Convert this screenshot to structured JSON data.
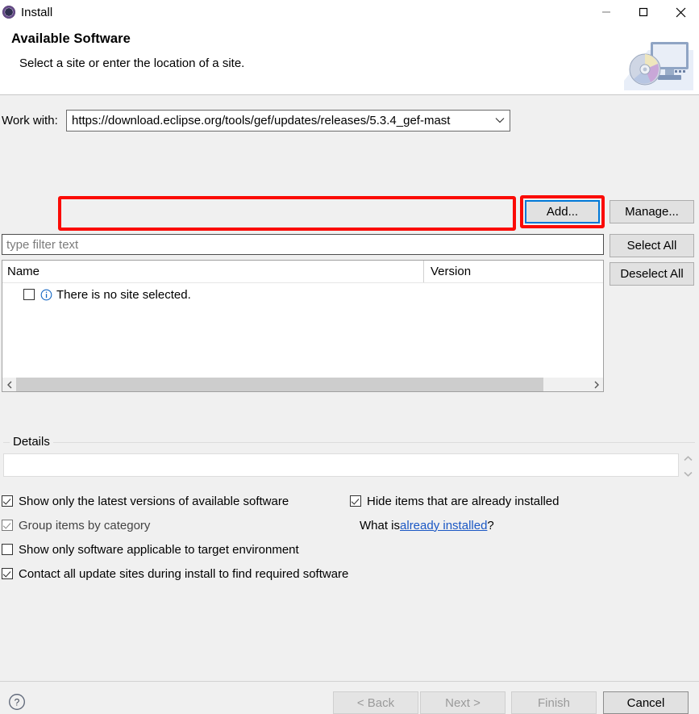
{
  "window": {
    "title": "Install",
    "app_icon": "install-gear-icon",
    "minimize_label": "Minimize",
    "maximize_label": "Maximize",
    "close_label": "Close"
  },
  "banner": {
    "heading": "Available Software",
    "subheading": "Select a site or enter the location of a site.",
    "graphic": "monitor-with-disc-icon"
  },
  "work_with": {
    "label": "Work with:",
    "value": "https://download.eclipse.org/tools/gef/updates/releases/5.3.4_gef-mast",
    "dropdown_icon": "chevron-down-icon",
    "add_label": "Add...",
    "manage_label": "Manage..."
  },
  "filter": {
    "placeholder": "type filter text",
    "value": ""
  },
  "table": {
    "columns": [
      "Name",
      "Version"
    ],
    "rows": [
      {
        "checked": false,
        "icon": "info-icon",
        "name": "There is no site selected.",
        "version": ""
      }
    ],
    "select_all_label": "Select All",
    "deselect_all_label": "Deselect All",
    "scroll_left_icon": "chevron-left-icon",
    "scroll_right_icon": "chevron-right-icon"
  },
  "details": {
    "legend": "Details",
    "text": "",
    "spinner_up_icon": "chevron-up-icon",
    "spinner_down_icon": "chevron-down-icon"
  },
  "options": {
    "left": [
      {
        "label": "Show only the latest versions of available software",
        "checked": true,
        "enabled": true
      },
      {
        "label": "Group items by category",
        "checked": true,
        "enabled": false
      },
      {
        "label": "Show only software applicable to target environment",
        "checked": false,
        "enabled": true
      },
      {
        "label": "Contact all update sites during install to find required software",
        "checked": true,
        "enabled": true
      }
    ],
    "right": {
      "hide_installed": {
        "label": "Hide items that are already installed",
        "checked": true
      },
      "what_is_prefix": "What is ",
      "what_is_link": "already installed",
      "what_is_suffix": "?"
    }
  },
  "footer": {
    "help_icon": "help-question-icon",
    "back_label": "< Back",
    "next_label": "Next >",
    "finish_label": "Finish",
    "cancel_label": "Cancel"
  },
  "annotations": {
    "highlight_color": "#fb0b05",
    "focus_color": "#0078d7",
    "highlighted": [
      "work-with-combo",
      "add-button"
    ]
  }
}
